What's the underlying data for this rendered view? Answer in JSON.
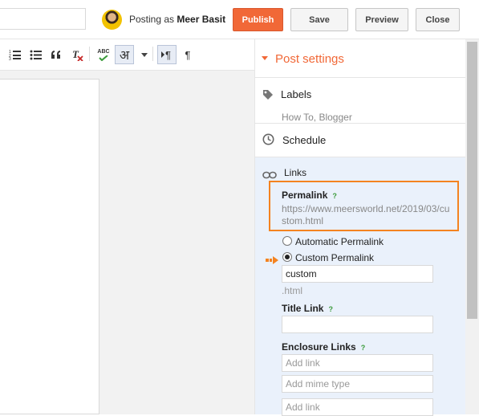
{
  "header": {
    "posting_as_prefix": "Posting as",
    "user_name": "Meer Basit",
    "publish_label": "Publish",
    "save_label": "Save",
    "preview_label": "Preview",
    "close_label": "Close"
  },
  "toolbar": {
    "spellcheck_label": "ABC",
    "hindi_glyph": "अ",
    "rtl_glyph": "¶"
  },
  "sidebar": {
    "title": "Post settings",
    "labels": {
      "title": "Labels",
      "value": "How To, Blogger"
    },
    "schedule": {
      "title": "Schedule"
    },
    "links": {
      "title": "Links",
      "permalink": {
        "title": "Permalink",
        "help": "?",
        "url": "https://www.meersworld.net/2019/03/custom.html"
      },
      "options": [
        {
          "label": "Automatic Permalink",
          "selected": false
        },
        {
          "label": "Custom Permalink",
          "selected": true
        }
      ],
      "custom_value": "custom",
      "suffix": ".html",
      "title_link": {
        "title": "Title Link",
        "help": "?",
        "value": ""
      },
      "enclosure_links": {
        "title": "Enclosure Links",
        "help": "?",
        "link_placeholder": "Add link",
        "mime_placeholder": "Add mime type"
      }
    }
  },
  "colors": {
    "accent": "#f16837",
    "highlight_border": "#f48320",
    "links_panel_bg": "#eaf1fb"
  }
}
